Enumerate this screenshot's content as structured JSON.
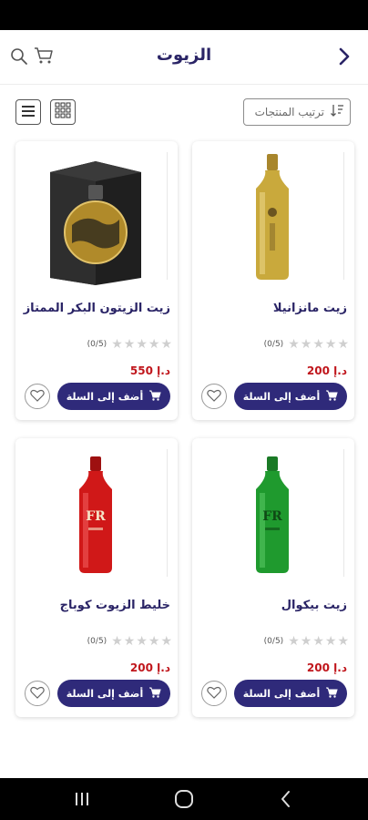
{
  "header": {
    "title": "الزيوت",
    "back_icon": "chevron-right-icon",
    "search_icon": "search-icon",
    "cart_icon": "cart-icon"
  },
  "toolbar": {
    "sort_label": "ترتيب المنتجات",
    "sort_icon": "sort-icon",
    "list_view_icon": "list-view-icon",
    "grid_view_icon": "grid-view-icon"
  },
  "products": [
    {
      "name": "زيت مانزانيلا",
      "rating_text": "(0/5)",
      "price": "200 د.إ",
      "add_label": "أضف إلى السلة",
      "bottle_color": "#c9a93c",
      "image": "gold-bottle"
    },
    {
      "name": "زيت الزيتون البكر الممتاز",
      "rating_text": "(0/5)",
      "price": "550 د.إ",
      "add_label": "أضف إلى السلة",
      "bottle_color": "#2a2a2a",
      "image": "gift-box-globe"
    },
    {
      "name": "زيت بيكوال",
      "rating_text": "(0/5)",
      "price": "200 د.إ",
      "add_label": "أضف إلى السلة",
      "bottle_color": "#1f9a2e",
      "image": "green-bottle"
    },
    {
      "name": "خليط الزيوت كوباج",
      "rating_text": "(0/5)",
      "price": "200 د.إ",
      "add_label": "أضف إلى السلة",
      "bottle_color": "#d01818",
      "image": "red-bottle"
    }
  ],
  "colors": {
    "primary": "#2f2a7a",
    "price": "#c0161c",
    "star_empty": "#cfcfcf"
  },
  "system_nav": {
    "recent_icon": "recent-apps-icon",
    "home_icon": "home-icon",
    "back_icon": "back-icon"
  }
}
